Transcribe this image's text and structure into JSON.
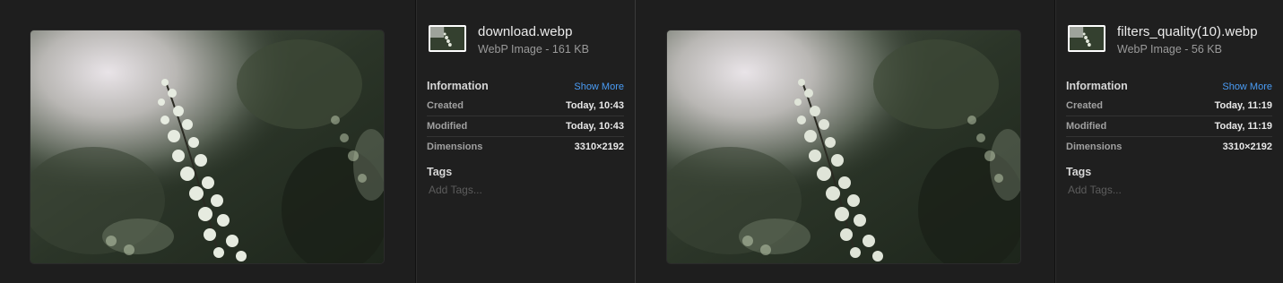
{
  "windows": [
    {
      "file": {
        "name": "download.webp",
        "kind": "WebP Image - 161 KB"
      },
      "information": {
        "title": "Information",
        "show_more": "Show More",
        "rows": [
          {
            "label": "Created",
            "value": "Today, 10:43"
          },
          {
            "label": "Modified",
            "value": "Today, 10:43"
          },
          {
            "label": "Dimensions",
            "value": "3310×2192"
          }
        ]
      },
      "tags": {
        "title": "Tags",
        "placeholder": "Add Tags..."
      }
    },
    {
      "file": {
        "name": "filters_quality(10).webp",
        "kind": "WebP Image - 56 KB"
      },
      "information": {
        "title": "Information",
        "show_more": "Show More",
        "rows": [
          {
            "label": "Created",
            "value": "Today, 11:19"
          },
          {
            "label": "Modified",
            "value": "Today, 11:19"
          },
          {
            "label": "Dimensions",
            "value": "3310×2192"
          }
        ]
      },
      "tags": {
        "title": "Tags",
        "placeholder": "Add Tags..."
      }
    }
  ],
  "colors": {
    "background": "#1e1e1e",
    "accent_link": "#4a9cf5",
    "text_primary": "#ececec",
    "text_secondary": "#9a9a9a"
  }
}
